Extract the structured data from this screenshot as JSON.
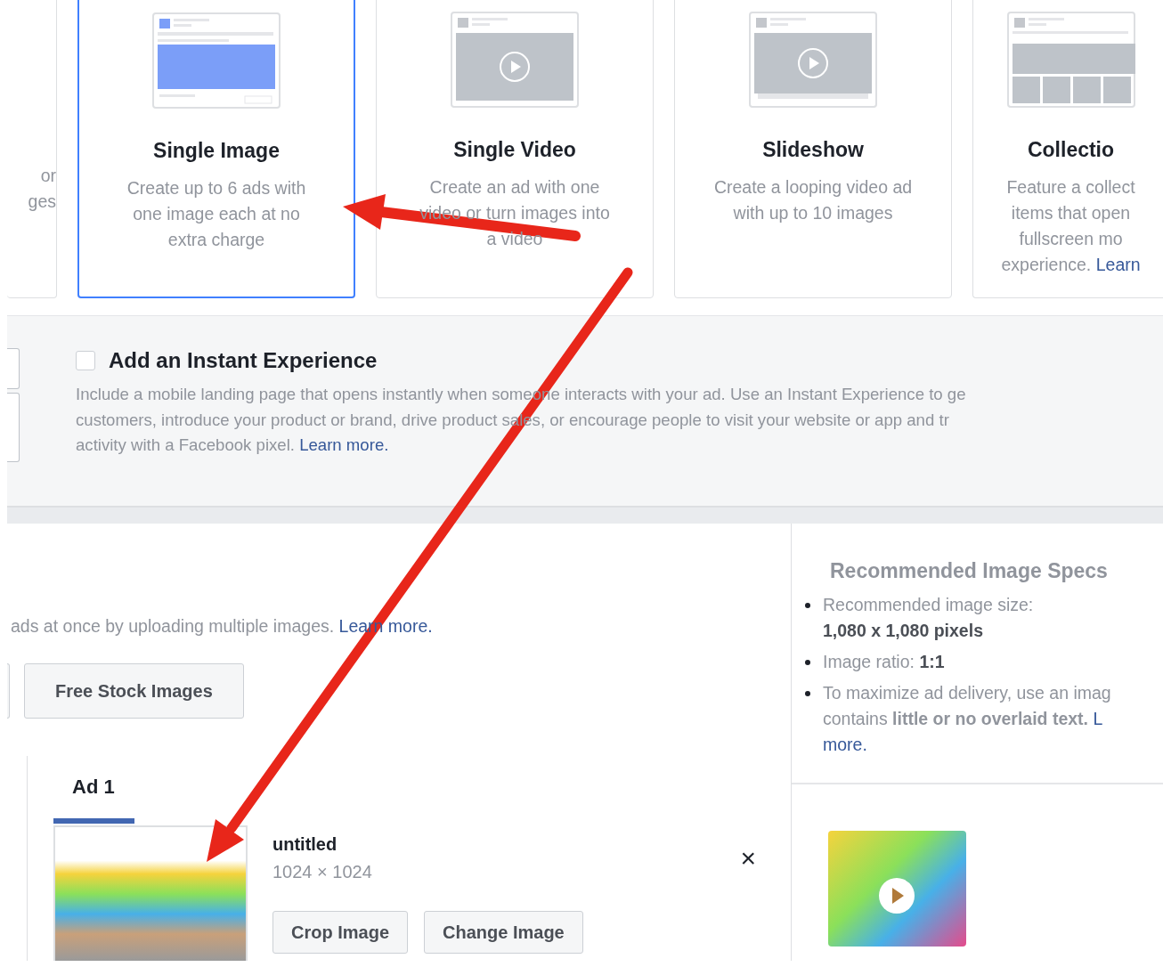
{
  "formats": [
    {
      "kind": "partial",
      "lines": [
        "or",
        "ges"
      ],
      "selected": false
    },
    {
      "kind": "image",
      "title": "Single Image",
      "lines": [
        "Create up to 6 ads with",
        "one image each at no",
        "extra charge"
      ],
      "selected": true
    },
    {
      "kind": "video",
      "title": "Single Video",
      "lines": [
        "Create an ad with one",
        "video or turn images into",
        "a video"
      ],
      "selected": false
    },
    {
      "kind": "slideshow",
      "title": "Slideshow",
      "lines": [
        "Create a looping video ad",
        "with up to 10 images"
      ],
      "selected": false
    },
    {
      "kind": "collection",
      "title": "Collectio",
      "lines": [
        "Feature a collect",
        "items that open",
        "fullscreen mo",
        "experience."
      ],
      "link": "Learn",
      "selected": false
    }
  ],
  "instant_experience": {
    "checked": false,
    "title": "Add an Instant Experience",
    "lines": [
      "Include a mobile landing page that opens instantly when someone interacts with your ad. Use an Instant Experience to ge",
      "customers, introduce your product or brand, drive product sales, or encourage people to visit your website or app and tr",
      "activity with a Facebook pixel."
    ],
    "link": "Learn more."
  },
  "media": {
    "intro": "ads at once by uploading multiple images.",
    "link": "Learn more.",
    "button": "Free Stock Images"
  },
  "ad_tabs": [
    {
      "label": "Ad 1",
      "selected": true
    }
  ],
  "image": {
    "name": "untitled",
    "size": "1024 × 1024",
    "close": "×",
    "buttons": [
      "Crop Image",
      "Change Image"
    ]
  },
  "specs": {
    "title": "Recommended Image Specs",
    "bullets": [
      {
        "kind": "stacked",
        "label": "Recommended image size:",
        "value": "1,080 x 1,080 pixels"
      },
      {
        "kind": "inline",
        "label": "Image ratio:",
        "value": "1:1"
      },
      {
        "kind": "note",
        "lines": [
          "To maximize ad delivery, use an imag",
          "contains **little or no overlaid text.**"
        ],
        "link": "L",
        "link_continued": "more."
      }
    ]
  }
}
